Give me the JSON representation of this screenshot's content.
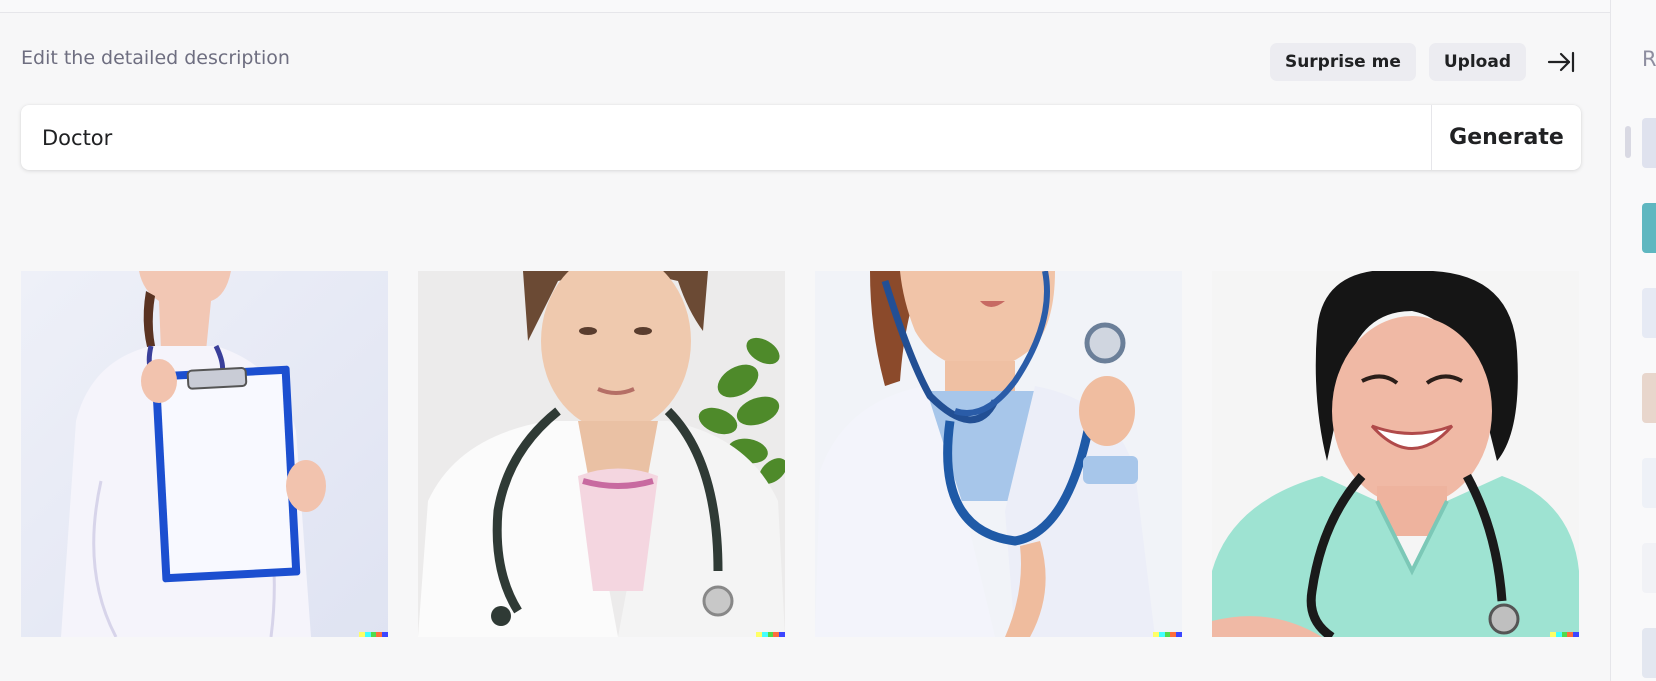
{
  "header": {
    "description_label": "Edit the detailed description",
    "surprise_label": "Surprise me",
    "upload_label": "Upload",
    "collapse_icon": "arrow-right-to-bar-icon"
  },
  "prompt": {
    "value": "Doctor",
    "generate_label": "Generate"
  },
  "results": {
    "images": [
      {
        "name": "generated-image-1",
        "alt": "doctor holding blank clipboard"
      },
      {
        "name": "generated-image-2",
        "alt": "doctor with stethoscope and plant"
      },
      {
        "name": "generated-image-3",
        "alt": "doctor holding stethoscope"
      },
      {
        "name": "generated-image-4",
        "alt": "smiling nurse in teal scrubs"
      }
    ],
    "watermark_colors": [
      "#ffff66",
      "#42ffff",
      "#51da4c",
      "#ff6e3c",
      "#3c46ff"
    ]
  },
  "sidebar": {
    "title": "R"
  },
  "colors": {
    "background": "#f7f7f8",
    "button_bg": "#ececf1",
    "text_primary": "#202123",
    "text_secondary": "#6e6e80"
  }
}
